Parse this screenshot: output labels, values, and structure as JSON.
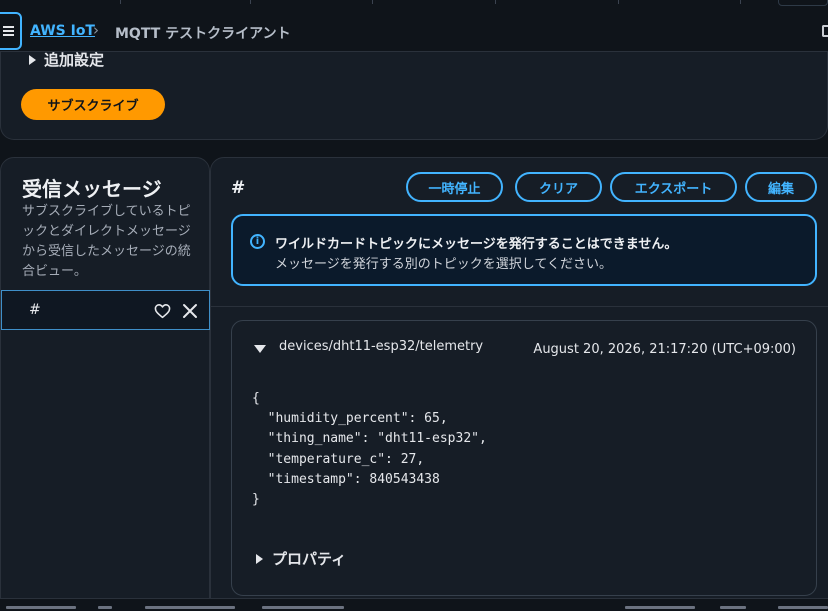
{
  "breadcrumb": {
    "service": "AWS IoT",
    "separator": "›",
    "current": "MQTT テストクライアント"
  },
  "top_panel": {
    "additional_settings_label": "追加設定",
    "subscribe_label": "サブスクライブ"
  },
  "left_panel": {
    "title": "受信メッセージ",
    "description": "サブスクライブしているトピックとダイレクトメッセージから受信したメッセージの統合ビュー。",
    "topics": [
      {
        "name": "#"
      }
    ]
  },
  "right_panel": {
    "topic_title": "#",
    "buttons": {
      "pause": "一時停止",
      "clear": "クリア",
      "export": "エクスポート",
      "edit": "編集"
    },
    "alert": {
      "title": "ワイルドカードトピックにメッセージを発行することはできません。",
      "body": "メッセージを発行する別のトピックを選択してください。"
    },
    "message": {
      "topic": "devices/dht11-esp32/telemetry",
      "timestamp": "August 20, 2026, 21:17:20 (UTC+09:00)",
      "payload": "{\n  \"humidity_percent\": 65,\n  \"thing_name\": \"dht11-esp32\",\n  \"temperature_c\": 27,\n  \"timestamp\": 840543438\n}",
      "properties_label": "プロパティ"
    }
  },
  "colors": {
    "accent": "#42b4ff",
    "primary_button": "#ff9900",
    "panel": "#161d26",
    "background": "#0f141a"
  }
}
